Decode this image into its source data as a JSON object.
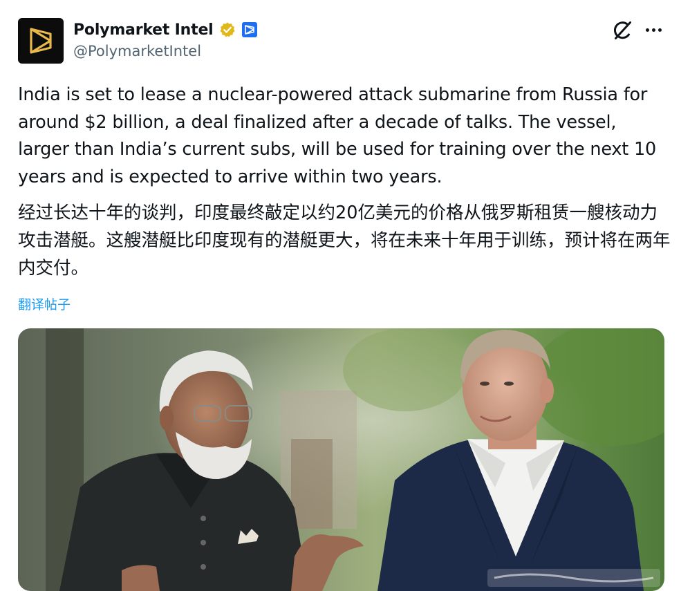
{
  "author": {
    "display_name": "Polymarket Intel",
    "handle": "@PolymarketIntel",
    "avatar_icon": "polymarket-logo-icon",
    "verified_icon": "verified-gold-badge-icon",
    "affiliate_icon": "polymarket-affiliate-badge-icon"
  },
  "actions": {
    "grok_icon": "grok-icon",
    "more_icon": "more-options-icon"
  },
  "post": {
    "text_en": "India is set to lease a nuclear-powered attack submarine from Russia for around $2 billion, a deal finalized after a decade of talks. The vessel, larger than India’s current subs, will be used for training over the next 10 years and is expected to arrive within two years.",
    "text_zh": "经过长达十年的谈判，印度最终敲定以约20亿美元的价格从俄罗斯租赁一艘核动力攻击潜艇。这艘潜艇比印度现有的潜艇更大，将在未来十年用于训练，预计将在两年内交付。",
    "translate_label": "翻译帖子"
  },
  "colors": {
    "link": "#1d9bf0",
    "text": "#0f1419",
    "secondary": "#536471",
    "verified_gold": "#e2b719",
    "affiliate_blue": "#1d6ff0"
  }
}
